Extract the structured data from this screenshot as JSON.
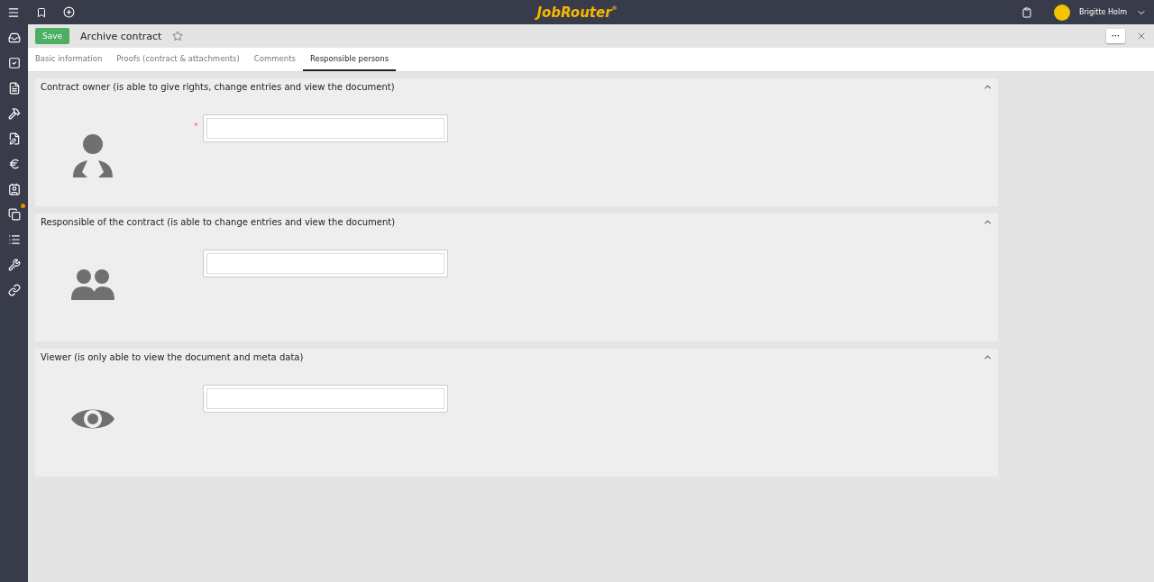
{
  "topbar": {
    "logo": "JobRouter",
    "logo_mark": "®",
    "user": "Brigitte Holm"
  },
  "sidebar": {
    "items": [
      {
        "kind": "inbox",
        "notified": false
      },
      {
        "kind": "check",
        "notified": false
      },
      {
        "kind": "document",
        "notified": false
      },
      {
        "kind": "hammer",
        "notified": false
      },
      {
        "kind": "form",
        "notified": false
      },
      {
        "kind": "euro",
        "notified": false
      },
      {
        "kind": "contact",
        "notified": false
      },
      {
        "kind": "copy",
        "notified": true
      },
      {
        "kind": "list",
        "notified": false
      },
      {
        "kind": "wrench",
        "notified": false
      },
      {
        "kind": "link",
        "notified": false
      }
    ]
  },
  "header": {
    "save": "Save",
    "title": "Archive contract",
    "more": "···"
  },
  "tabs": [
    {
      "label": "Basic information",
      "selected": false
    },
    {
      "label": "Proofs (contract & attachments)",
      "selected": false
    },
    {
      "label": "Comments",
      "selected": false
    },
    {
      "label": "Responsible persons",
      "selected": true
    }
  ],
  "sections": [
    {
      "kind": "owner",
      "title": "Contract owner (is able to give rights, change entries and view the document)",
      "required_mark": "*",
      "expanded": true
    },
    {
      "kind": "responsible",
      "title": "Responsible of the contract (is able to change entries and view the document)",
      "expanded": true
    },
    {
      "kind": "viewer",
      "title": "Viewer (is only able to view the document and meta data)",
      "expanded": true
    }
  ]
}
